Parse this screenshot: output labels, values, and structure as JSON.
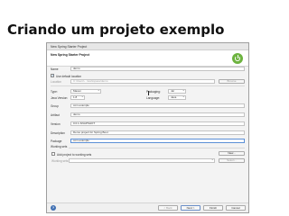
{
  "slide": {
    "title": "Criando um projeto exemplo"
  },
  "window": {
    "title": "New Spring Starter Project"
  },
  "form": {
    "name_label": "Name",
    "name_value": "demo",
    "use_default_location_label": "Use default location",
    "location_label": "Location",
    "location_value": "C:\\Users\\...\\workspace\\demo",
    "browse_label": "Browse",
    "type_label": "Type:",
    "type_value": "Maven",
    "packaging_label": "Packaging:",
    "packaging_value": "Jar",
    "java_version_label": "Java Version:",
    "java_version_value": "1.8",
    "language_label": "Language:",
    "language_value": "Java",
    "group_label": "Group",
    "group_value": "com.example",
    "artifact_label": "Artifact",
    "artifact_value": "demo",
    "version_label": "Version",
    "version_value": "0.0.1-SNAPSHOT",
    "description_label": "Description",
    "description_value": "Demo project for Spring Boot",
    "package_label": "Package",
    "package_value": "com.example",
    "working_sets_label": "Working sets",
    "add_to_working_sets_label": "Add project to working sets",
    "new_label": "New...",
    "working_sets_field_label": "Working sets:",
    "select_label": "Select..."
  },
  "footer": {
    "back_label": "< Back",
    "next_label": "Next >",
    "finish_label": "Finish",
    "cancel_label": "Cancel"
  },
  "colors": {
    "spring_green": "#6db33f",
    "help_blue": "#3f6fb2"
  }
}
